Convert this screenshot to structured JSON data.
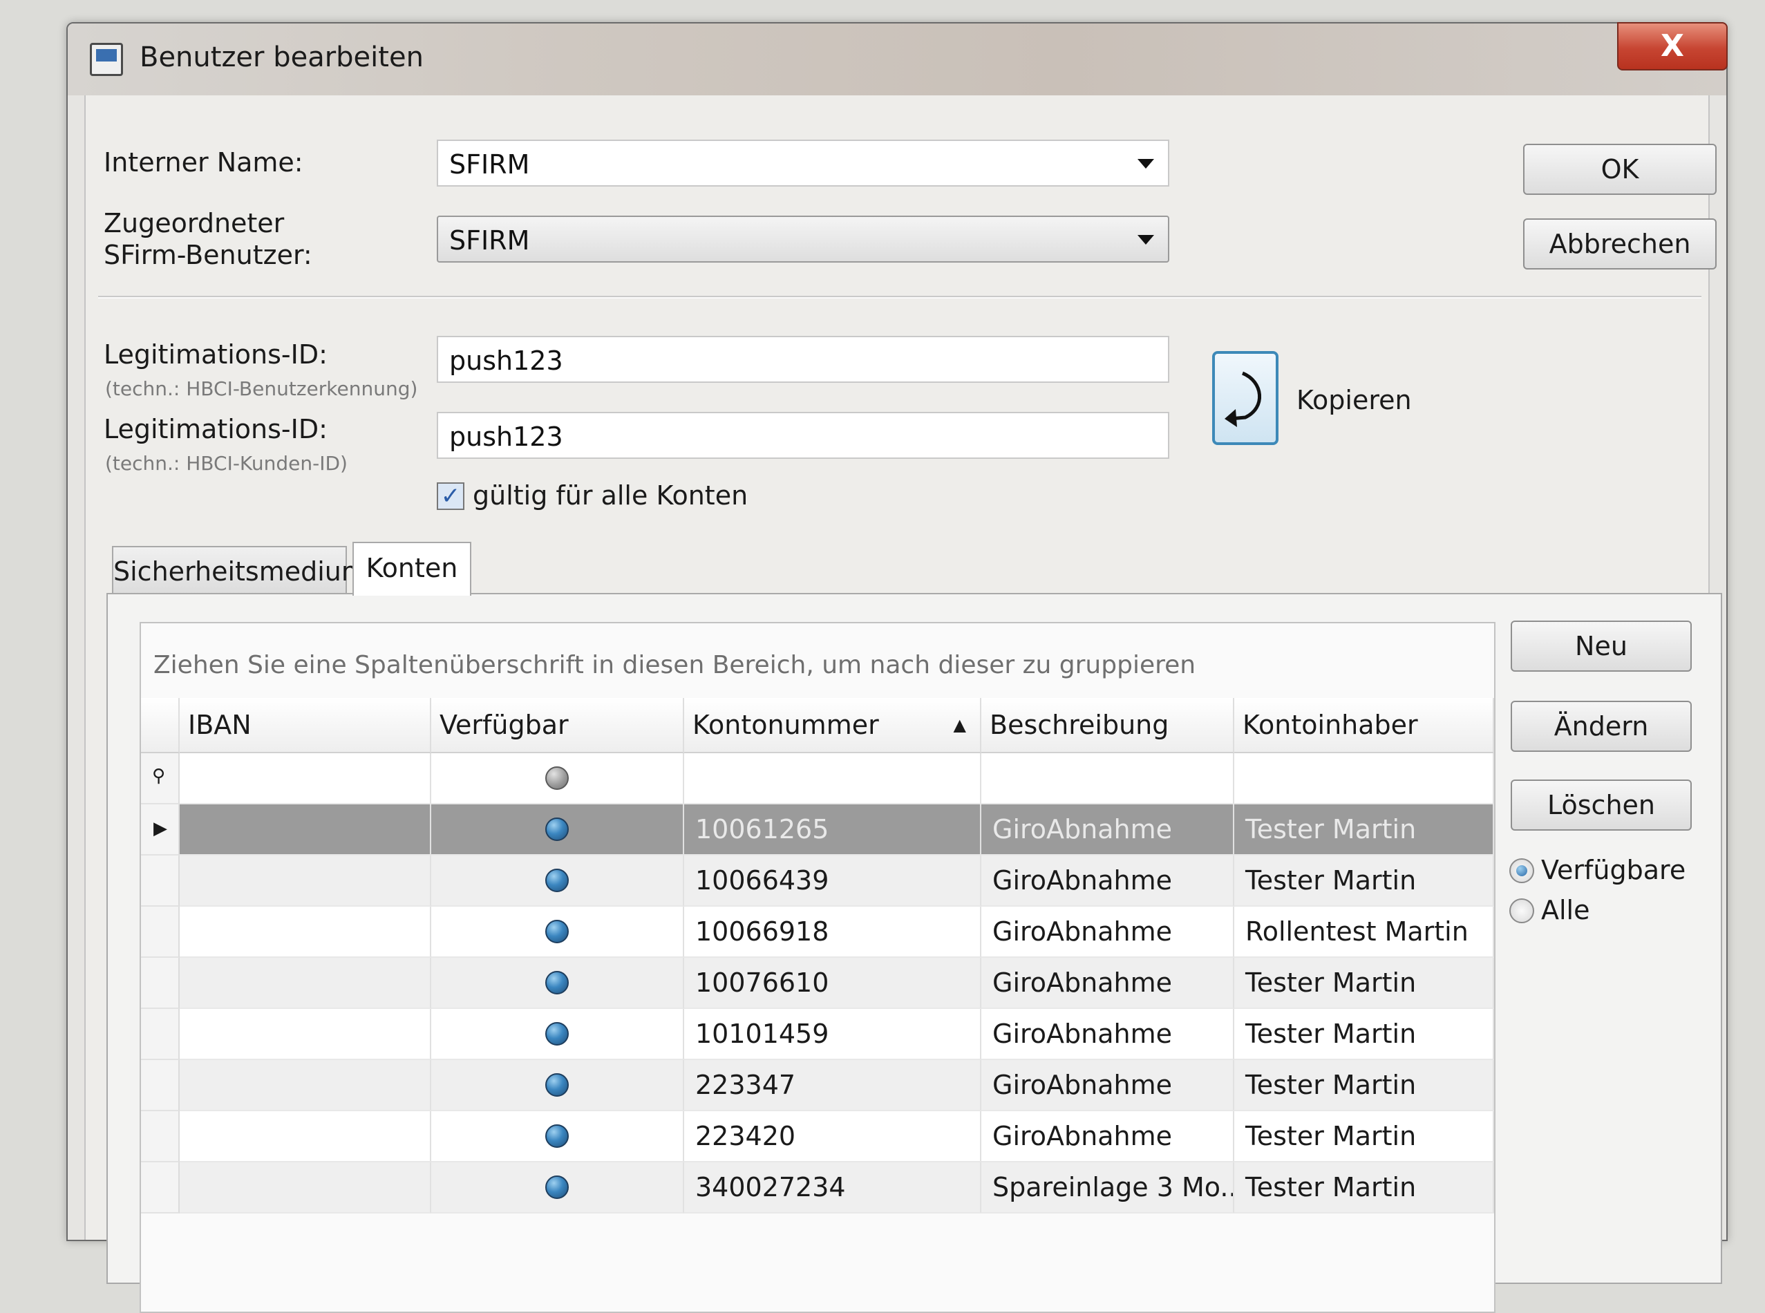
{
  "window": {
    "title": "Benutzer bearbeiten",
    "close_glyph": "X"
  },
  "form": {
    "internal_name_label": "Interner Name:",
    "internal_name_value": "SFIRM",
    "sfirm_user_label_line1": "Zugeordneter",
    "sfirm_user_label_line2": "SFirm-Benutzer:",
    "sfirm_user_value": "SFIRM",
    "legit1_label": "Legitimations-ID:",
    "legit1_hint": "(techn.: HBCI-Benutzerkennung)",
    "legit1_value": "push123",
    "legit2_label": "Legitimations-ID:",
    "legit2_hint": "(techn.: HBCI-Kunden-ID)",
    "legit2_value": "push123",
    "valid_all_label": "gültig für alle Konten",
    "valid_all_checked": true,
    "copy_label": "Kopieren"
  },
  "buttons": {
    "ok": "OK",
    "cancel": "Abbrechen",
    "new": "Neu",
    "change": "Ändern",
    "delete": "Löschen"
  },
  "tabs": [
    {
      "label": "Sicherheitsmedium",
      "active": false
    },
    {
      "label": "Konten",
      "active": true
    }
  ],
  "grid": {
    "group_hint": "Ziehen Sie eine Spaltenüberschrift in diesen Bereich, um nach dieser zu gruppieren",
    "columns": [
      "IBAN",
      "Verfügbar",
      "Kontonummer",
      "Beschreibung",
      "Kontoinhaber"
    ],
    "sorted_column": "Kontonummer",
    "rows": [
      {
        "iban": "",
        "konto": "10061265",
        "beschreibung": "GiroAbnahme",
        "inhaber": "Tester Martin",
        "selected": true
      },
      {
        "iban": "",
        "konto": "10066439",
        "beschreibung": "GiroAbnahme",
        "inhaber": "Tester Martin",
        "selected": false
      },
      {
        "iban": "",
        "konto": "10066918",
        "beschreibung": "GiroAbnahme",
        "inhaber": "Rollentest Martin",
        "selected": false
      },
      {
        "iban": "",
        "konto": "10076610",
        "beschreibung": "GiroAbnahme",
        "inhaber": "Tester Martin",
        "selected": false
      },
      {
        "iban": "",
        "konto": "10101459",
        "beschreibung": "GiroAbnahme",
        "inhaber": "Tester Martin",
        "selected": false
      },
      {
        "iban": "",
        "konto": "223347",
        "beschreibung": "GiroAbnahme",
        "inhaber": "Tester Martin",
        "selected": false
      },
      {
        "iban": "",
        "konto": "223420",
        "beschreibung": "GiroAbnahme",
        "inhaber": "Tester Martin",
        "selected": false
      },
      {
        "iban": "",
        "konto": "340027234",
        "beschreibung": "Spareinlage 3 Mo...",
        "inhaber": "Tester Martin",
        "selected": false
      }
    ]
  },
  "filter": {
    "available_label": "Verfügbare",
    "all_label": "Alle",
    "selected": "available"
  },
  "colors": {
    "selected_row": "#9b9b9b",
    "status_dot": "#3b86c0",
    "close_button": "#c74532"
  },
  "icons": [
    "window-app-icon",
    "close-icon",
    "dropdown-arrow-icon",
    "copy-arrow-icon",
    "checkmark-icon",
    "filter-row-icon",
    "row-pointer-icon",
    "sort-ascending-icon",
    "status-dot-icon"
  ]
}
